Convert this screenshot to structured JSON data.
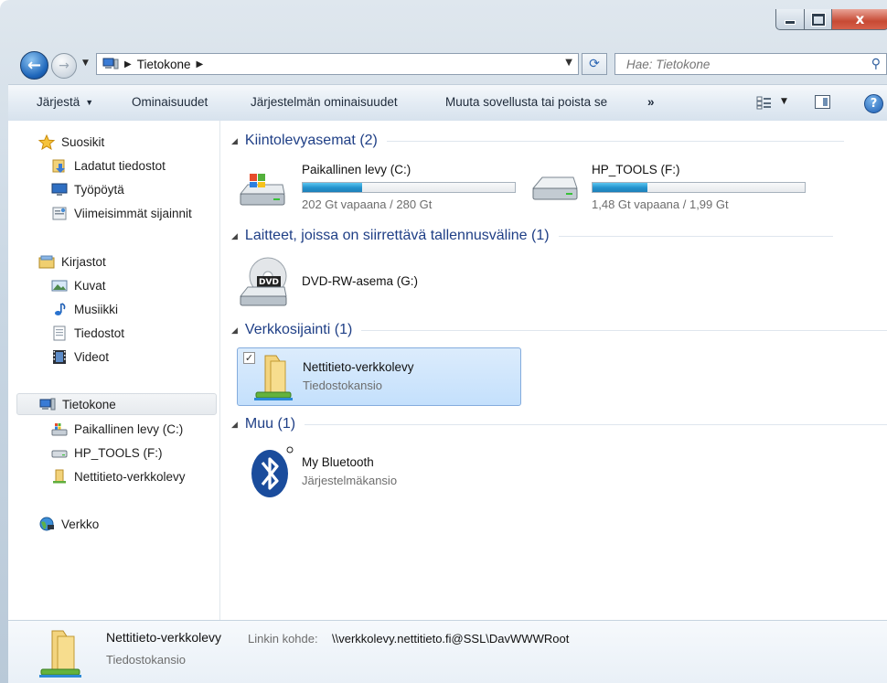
{
  "window": {
    "close_glyph": "x"
  },
  "nav": {
    "back_glyph": "←",
    "forward_glyph": "→",
    "address_crumbs": [
      "Tietokone"
    ],
    "search_placeholder": "Hae: Tietokone"
  },
  "toolbar": {
    "organize": "Järjestä",
    "properties": "Ominaisuudet",
    "system_properties": "Järjestelmän ominaisuudet",
    "uninstall": "Muuta sovellusta tai poista se",
    "more": "»"
  },
  "sidebar": {
    "favorites": {
      "label": "Suosikit",
      "items": [
        "Ladatut tiedostot",
        "Työpöytä",
        "Viimeisimmät sijainnit"
      ]
    },
    "libraries": {
      "label": "Kirjastot",
      "items": [
        "Kuvat",
        "Musiikki",
        "Tiedostot",
        "Videot"
      ]
    },
    "computer": {
      "label": "Tietokone",
      "items": [
        "Paikallinen levy (C:)",
        "HP_TOOLS (F:)",
        "Nettitieto-verkkolevy"
      ]
    },
    "network": {
      "label": "Verkko"
    }
  },
  "main": {
    "groups": [
      {
        "title": "Kiintolevyasemat (2)"
      },
      {
        "title": "Laitteet, joissa on siirrettävä tallennusväline (1)"
      },
      {
        "title": "Verkkosijainti (1)"
      },
      {
        "title": "Muu (1)"
      }
    ],
    "drives": [
      {
        "name": "Paikallinen levy (C:)",
        "info": "202 Gt vapaana / 280 Gt",
        "used_fraction": 0.28
      },
      {
        "name": "HP_TOOLS (F:)",
        "info": "1,48 Gt vapaana / 1,99 Gt",
        "used_fraction": 0.26
      }
    ],
    "removable": {
      "name": "DVD-RW-asema (G:)",
      "badge": "DVD"
    },
    "network_location": {
      "name": "Nettitieto-verkkolevy",
      "type": "Tiedostokansio"
    },
    "other": {
      "name": "My Bluetooth",
      "type": "Järjestelmäkansio"
    }
  },
  "details": {
    "title": "Nettitieto-verkkolevy",
    "link_label": "Linkin kohde:",
    "link_value": "\\\\verkkolevy.nettitieto.fi@SSL\\DavWWWRoot",
    "type": "Tiedostokansio"
  }
}
